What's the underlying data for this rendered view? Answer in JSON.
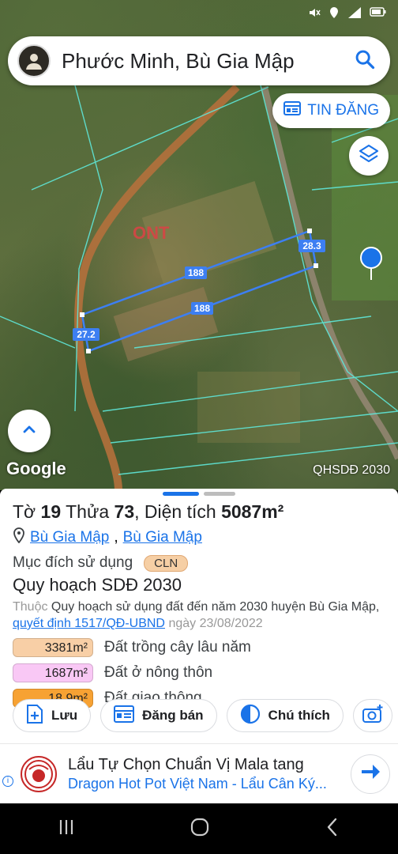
{
  "search": {
    "location_text": "Phước Minh, Bù Gia Mập"
  },
  "map": {
    "tin_dang_label": "TIN ĐĂNG",
    "google_label": "Google",
    "layer_label": "QHSDĐ 2030",
    "zone_label": "ONT",
    "parcel_labels": {
      "top_length": "188",
      "bottom_length": "188",
      "left_width": "27.2",
      "right_width": "28.3"
    }
  },
  "panel": {
    "title_prefix": "Tờ",
    "sheet_no": "19",
    "parcel_word": "Thửa",
    "parcel_no": "73",
    "area_word": "Diện tích",
    "area_value": "5087m²",
    "location_a": "Bù Gia Mập",
    "location_b": "Bù Gia Mập",
    "purpose_label": "Mục đích sử dụng",
    "purpose_code": "CLN",
    "plan_title": "Quy hoạch SDĐ 2030",
    "plan_desc_prefix": "Thuộc",
    "plan_desc_main": "Quy hoạch sử dụng đất đến năm 2030 huyện Bù Gia Mập",
    "plan_desc_link": "quyết định 1517/QĐ-UBND",
    "plan_desc_date": "ngày 23/08/2022",
    "areas": [
      {
        "value": "3381m²",
        "label": "Đất trồng cây lâu năm",
        "color": "#f8cfa6"
      },
      {
        "value": "1687m²",
        "label": "Đất ở nông thôn",
        "color": "#f9c8f5"
      },
      {
        "value": "18.9m²",
        "label": "Đất giao thông",
        "color": "#f7a233"
      }
    ],
    "actions": {
      "save": "Lưu",
      "post": "Đăng bán",
      "legend": "Chú thích"
    }
  },
  "ad": {
    "title": "Lẩu Tự Chọn Chuẩn Vị Mala tang",
    "subtitle": "Dragon Hot Pot Việt Nam - Lẩu Cân Ký...",
    "info": "i"
  },
  "colors": {
    "accent": "#1a73e8",
    "parcel_line": "#3d7ff2",
    "plan_line": "#5fe7d9"
  }
}
